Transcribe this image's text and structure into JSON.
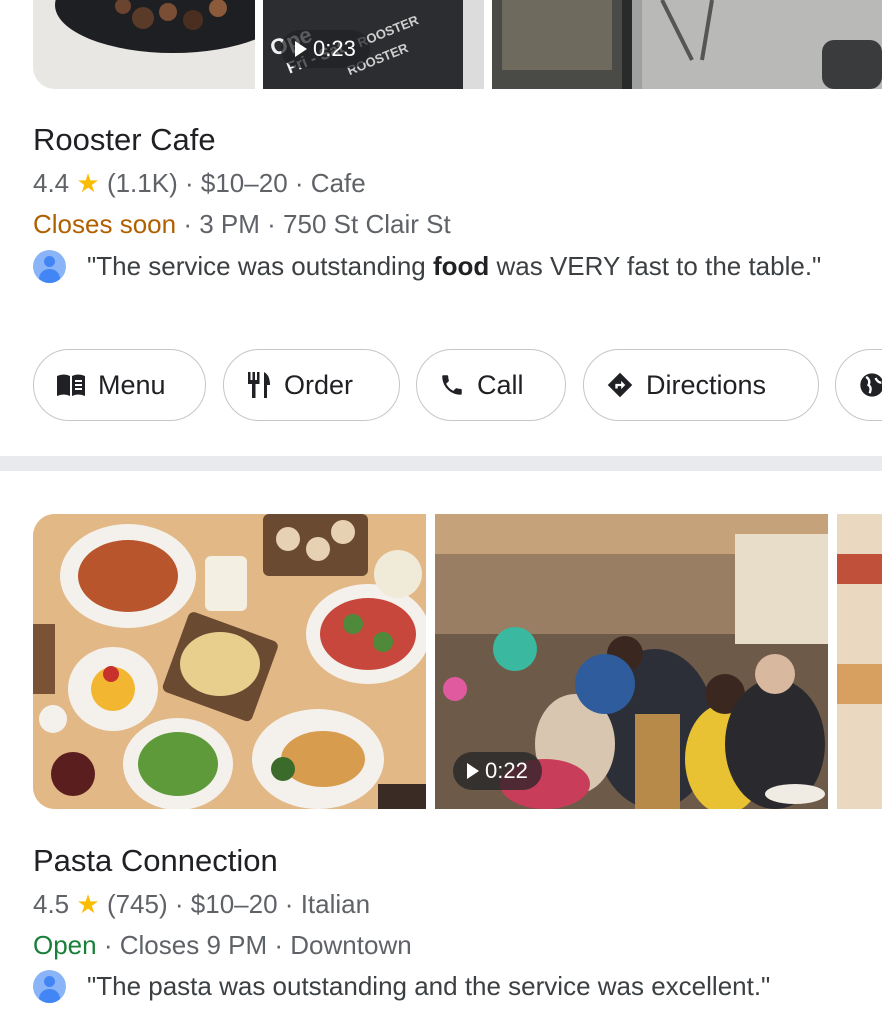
{
  "listings": [
    {
      "name": "Rooster Cafe",
      "rating": "4.4",
      "star": "★",
      "reviews": "(1.1K)",
      "price": "$10–20",
      "category": "Cafe",
      "status": "Closes soon",
      "hours": "3 PM",
      "address": "750 St Clair St",
      "review_before": "\"The service was outstanding ",
      "review_bold": "food",
      "review_after": " was VERY fast to the table.\"",
      "video_duration": "0:23",
      "sign_text_1": "Ope",
      "sign_text_2": "Fri - Sat",
      "sign_text_3": "ROOSTER"
    },
    {
      "name": "Pasta Connection",
      "rating": "4.5",
      "star": "★",
      "reviews": "(745)",
      "price": "$10–20",
      "category": "Italian",
      "status": "Open",
      "hours": "Closes 9 PM",
      "address": "Downtown",
      "review": "\"The pasta was outstanding and the service was excellent.\"",
      "video_duration": "0:22"
    }
  ],
  "separator": "·",
  "actions": [
    {
      "label": "Menu",
      "icon": "menu-book-icon"
    },
    {
      "label": "Order",
      "icon": "restaurant-icon"
    },
    {
      "label": "Call",
      "icon": "phone-icon"
    },
    {
      "label": "Directions",
      "icon": "directions-icon"
    },
    {
      "label": "",
      "icon": "globe-icon"
    }
  ],
  "colors": {
    "closes_soon": "#b06000",
    "open": "#188038",
    "star": "#fbbc04",
    "divider": "#e8eaed"
  }
}
